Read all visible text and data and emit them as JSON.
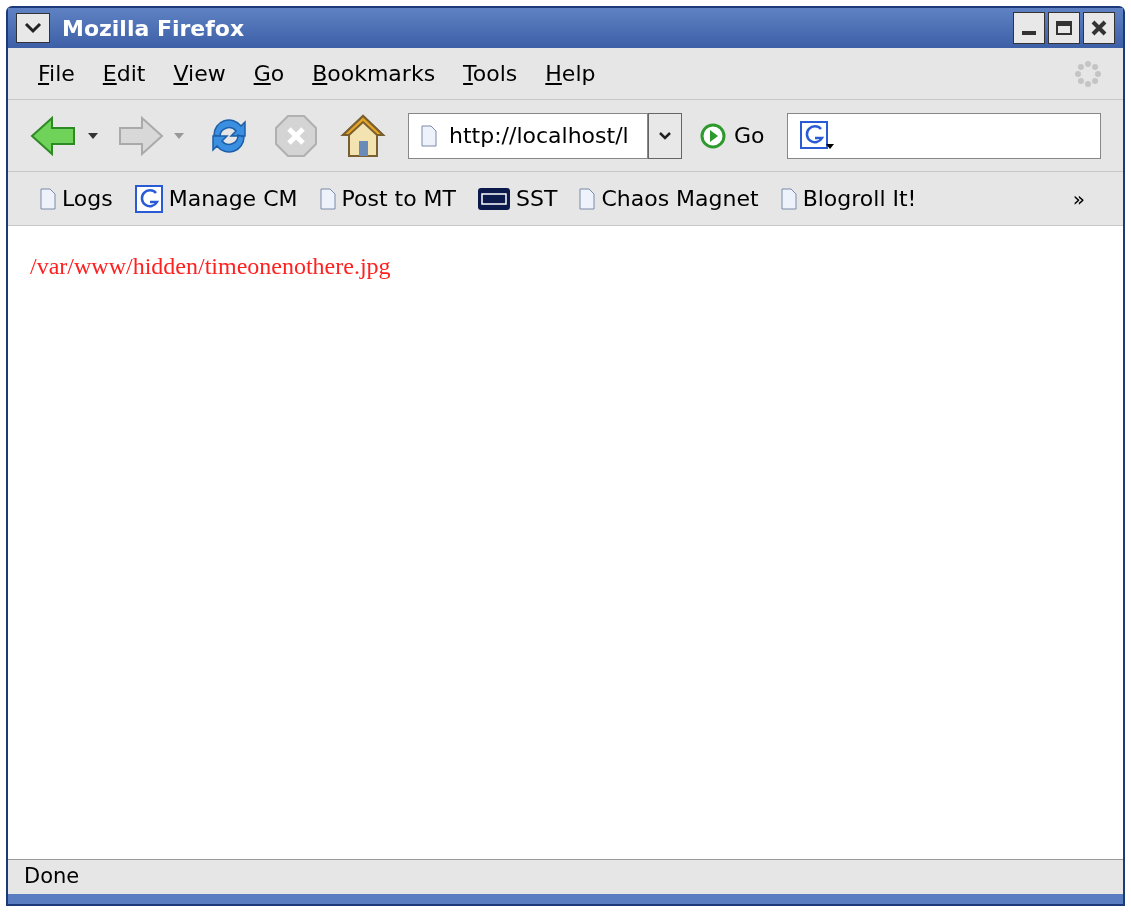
{
  "window": {
    "title": "Mozilla Firefox"
  },
  "menu": [
    "File",
    "Edit",
    "View",
    "Go",
    "Bookmarks",
    "Tools",
    "Help"
  ],
  "toolbar": {
    "url": "http://localhost/l",
    "go_label": "Go"
  },
  "bookmarks": [
    {
      "label": "Logs",
      "kind": "page"
    },
    {
      "label": "Manage CM",
      "kind": "google"
    },
    {
      "label": "Post to MT",
      "kind": "page"
    },
    {
      "label": "SST",
      "kind": "sst"
    },
    {
      "label": "Chaos Magnet",
      "kind": "page"
    },
    {
      "label": "Blogroll It!",
      "kind": "page"
    }
  ],
  "bookmarks_overflow": "»",
  "content": {
    "text": "/var/www/hidden/timeonenothere.jpg"
  },
  "status_bar": "Done"
}
